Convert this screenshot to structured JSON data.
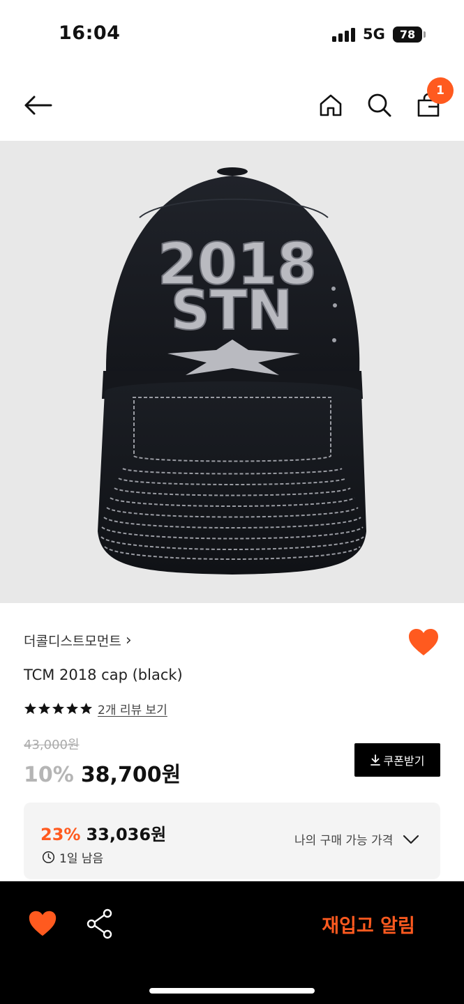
{
  "status_bar": {
    "time": "16:04",
    "network": "5G",
    "battery": "78"
  },
  "header": {
    "back_icon": "arrow-left-icon",
    "home_icon": "home-icon",
    "search_icon": "search-icon",
    "cart_icon": "shopping-bag-icon",
    "cart_count": "1",
    "accent_color": "#ff5a1f"
  },
  "product_image": {
    "embroidery_line1": "2018",
    "embroidery_line2": "STN"
  },
  "product": {
    "brand": "더콜디스트모먼트",
    "brand_chevron": "›",
    "name": "TCM 2018 cap (black)",
    "rating_stars": 5,
    "review_link": "2개 리뷰 보기",
    "original_price": "43,000원",
    "discount_rate": "10%",
    "sale_price": "38,700원",
    "coupon_label": "쿠폰받기",
    "wishlisted": true
  },
  "personal_price": {
    "discount_rate": "23%",
    "price": "33,036원",
    "time_left": "1일 남음",
    "toggle_label": "나의 구매 가능 가격"
  },
  "bottom_bar": {
    "like_icon": "heart-icon",
    "share_icon": "share-icon",
    "restock_label": "재입고 알림"
  }
}
